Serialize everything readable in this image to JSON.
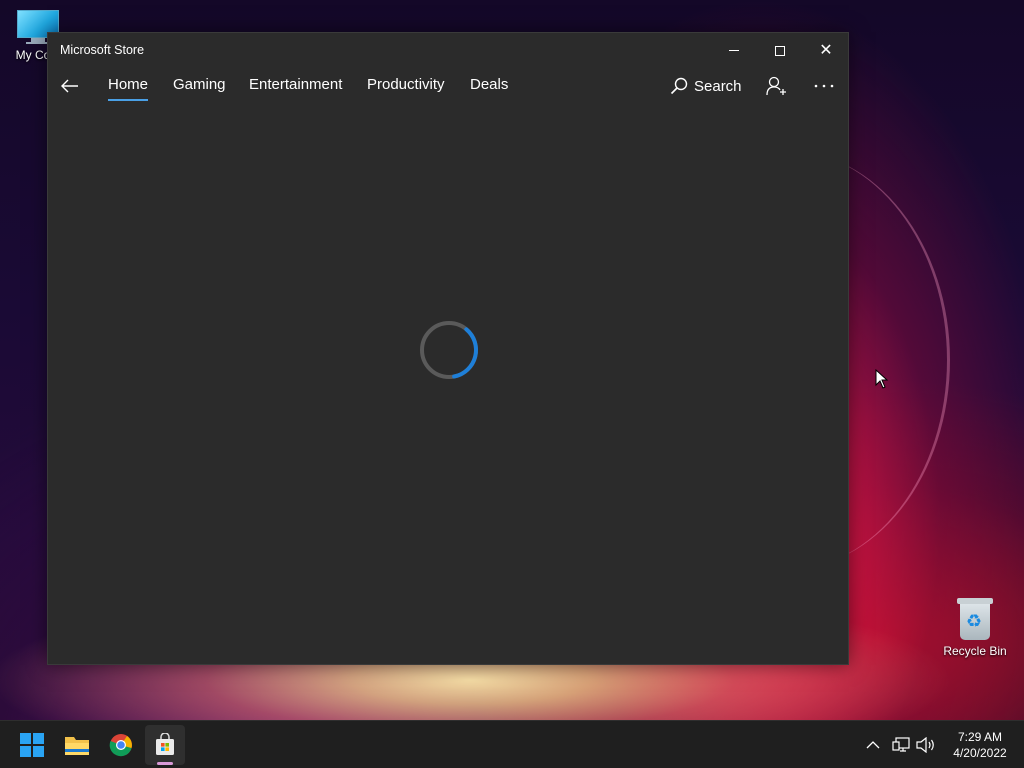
{
  "desktop": {
    "icons": [
      {
        "label": "My Com"
      },
      {
        "label": "Recycle Bin"
      }
    ]
  },
  "window": {
    "title": "Microsoft Store",
    "nav": {
      "items": [
        "Home",
        "Gaming",
        "Entertainment",
        "Productivity",
        "Deals"
      ],
      "active": "Home",
      "search_label": "Search"
    },
    "state": "loading"
  },
  "taskbar": {
    "apps": [
      "start-icon",
      "file-explorer-icon",
      "chrome-icon",
      "microsoft-store-icon"
    ],
    "active_app": "microsoft-store-icon",
    "clock": {
      "time": "7:29 AM",
      "date": "4/20/2022"
    }
  },
  "colors": {
    "accent": "#4aa0e6",
    "window_bg": "#2b2b2b",
    "taskbar_bg": "#1f1f1f"
  }
}
